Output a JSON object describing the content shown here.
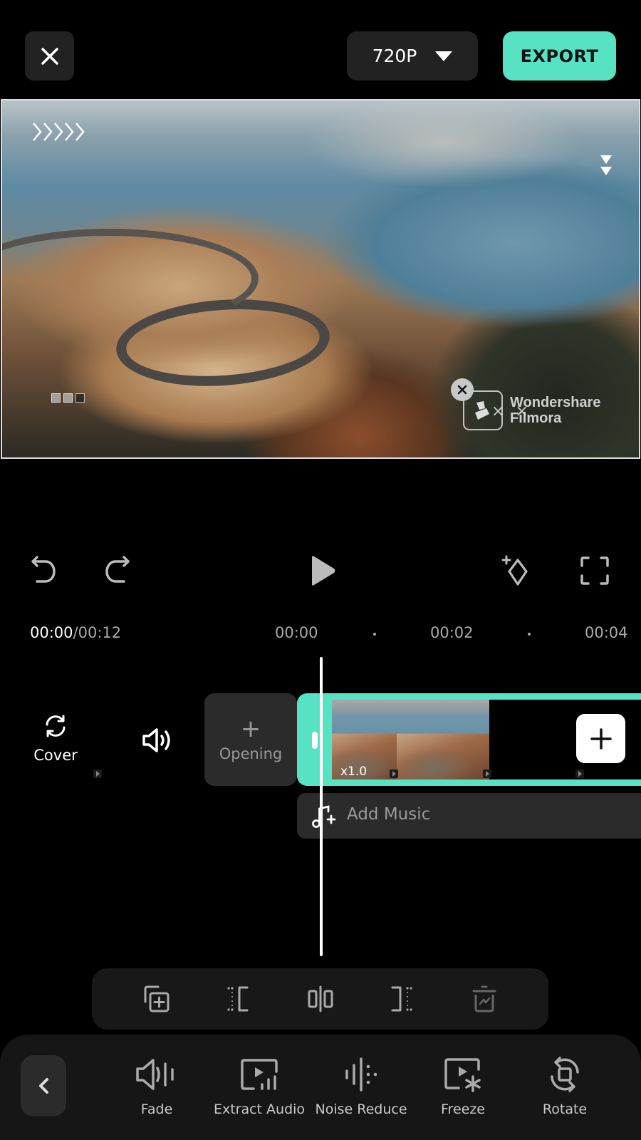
{
  "header": {
    "close_icon": "close-icon",
    "resolution": "720P",
    "export_label": "EXPORT"
  },
  "preview": {
    "watermark_line1": "Wondershare",
    "watermark_line2": "Filmora",
    "watermark_x_marks": "× ×"
  },
  "playback": {
    "undo_icon": "undo-icon",
    "redo_icon": "redo-icon",
    "play_icon": "play-icon",
    "keyframe_icon": "add-keyframe-icon",
    "fullscreen_icon": "fullscreen-icon",
    "current_time": "00:00",
    "total_time": "/00:12",
    "ruler": [
      "00:00",
      "00:02",
      "00:04"
    ]
  },
  "timeline": {
    "cover_label": "Cover",
    "opening_plus": "+",
    "opening_label": "Opening",
    "clip_speed": "x1.0",
    "add_music_label": "Add Music"
  },
  "edit_toolbar": {
    "items": [
      "copy-icon",
      "trim-start-icon",
      "split-icon",
      "trim-end-icon",
      "delete-icon"
    ]
  },
  "tools": {
    "back_icon": "chevron-left-icon",
    "items": [
      {
        "label": "Fade",
        "icon": "fade-icon"
      },
      {
        "label": "Extract Audio",
        "icon": "extract-audio-icon"
      },
      {
        "label": "Noise Reduce",
        "icon": "noise-reduce-icon"
      },
      {
        "label": "Freeze",
        "icon": "freeze-icon"
      },
      {
        "label": "Rotate",
        "icon": "rotate-icon"
      }
    ]
  },
  "colors": {
    "accent": "#57e2c4",
    "panel": "#161616",
    "button_bg": "#222222"
  }
}
